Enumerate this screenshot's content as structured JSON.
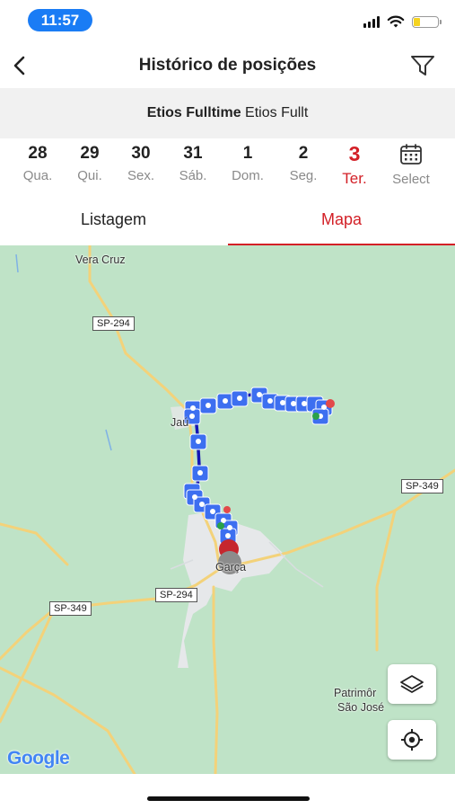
{
  "status": {
    "time": "11:57"
  },
  "nav": {
    "title": "Histórico de posições",
    "back_icon": "chevron-left-icon",
    "filter_icon": "filter-funnel-icon"
  },
  "vehicle": {
    "name_bold": "Etios Fulltime",
    "name_regular": "Etios Fullt"
  },
  "days": [
    {
      "num": "28",
      "weekday": "Qua."
    },
    {
      "num": "29",
      "weekday": "Qui."
    },
    {
      "num": "30",
      "weekday": "Sex."
    },
    {
      "num": "31",
      "weekday": "Sáb."
    },
    {
      "num": "1",
      "weekday": "Dom."
    },
    {
      "num": "2",
      "weekday": "Seg."
    },
    {
      "num": "3",
      "weekday": "Ter."
    }
  ],
  "select_label": "Select",
  "tabs": {
    "list": "Listagem",
    "map": "Mapa"
  },
  "map": {
    "places": {
      "vera_cruz": "Vera Cruz",
      "jau": "Jaú",
      "garca": "Garça",
      "patrimonio_1": "Patrimôr",
      "patrimonio_2": "São José"
    },
    "roads": {
      "sp294_a": "SP-294",
      "sp294_b": "SP-294",
      "sp349_a": "SP-349",
      "sp349_b": "SP-349"
    },
    "attribution": "Google",
    "layers_icon": "layers-icon",
    "locate_icon": "my-location-icon"
  },
  "colors": {
    "accent": "#d32027",
    "route": "#1515b5",
    "marker": "#3d6ff0",
    "map_bg": "#bfe3c7",
    "urban": "#e9ecef"
  }
}
